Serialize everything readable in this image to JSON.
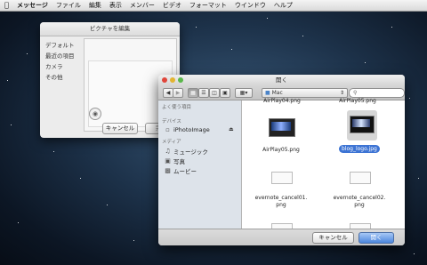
{
  "menubar": {
    "app": "メッセージ",
    "items": [
      "ファイル",
      "編集",
      "表示",
      "メンバー",
      "ビデオ",
      "フォーマット",
      "ウインドウ",
      "ヘルプ"
    ]
  },
  "edit_window": {
    "title": "ピクチャを編集",
    "sidebar": [
      "デフォルト",
      "最近の項目",
      "カメラ",
      "その他"
    ],
    "cancel": "キャンセル",
    "done": "完"
  },
  "open_dialog": {
    "title": "開く",
    "location": "Mac",
    "search_placeholder": "",
    "sidebar": {
      "favorites_header": "よく使う項目",
      "devices_header": "デバイス",
      "device": "iPhotoImage",
      "media_header": "メディア",
      "media": [
        "ミュージック",
        "写真",
        "ムービー"
      ]
    },
    "files": [
      {
        "name": "AirPlay04.png",
        "cropped": true
      },
      {
        "name": "AirPlay05.png",
        "cropped": true
      },
      {
        "name": "AirPlay05.png"
      },
      {
        "name": "blog_logo.jpg",
        "selected": true
      },
      {
        "name": "evernote_cancel01.\npng"
      },
      {
        "name": "evernote_cancel02.\npng"
      }
    ],
    "cancel": "キャンセル",
    "open": "開く"
  },
  "colors": {
    "accent": "#3d74d4",
    "close": "#e0453a",
    "min": "#e3b431",
    "zoom": "#5ab74a"
  }
}
